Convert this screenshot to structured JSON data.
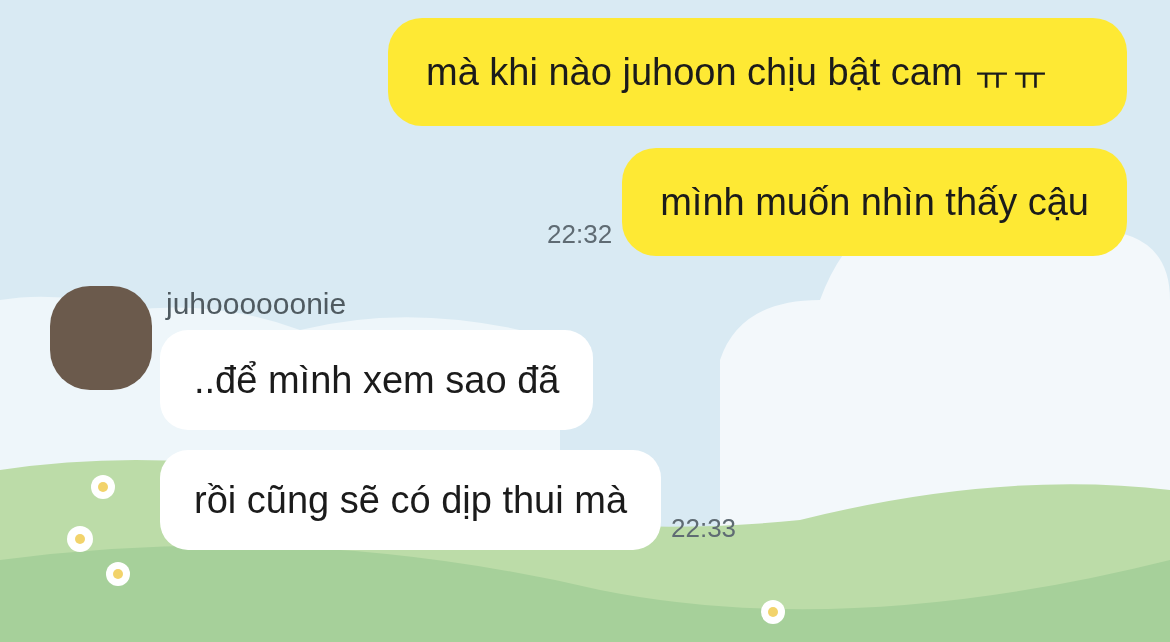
{
  "conversation": [
    {
      "kind": "outgoing",
      "bubbles": [
        {
          "text": "mà khi nào juhoon chịu bật cam ㅠㅠ"
        },
        {
          "text": "mình muốn nhìn thấy cậu",
          "time": "22:32"
        }
      ]
    },
    {
      "kind": "incoming",
      "sender": "juhoooooonie",
      "bubbles": [
        {
          "text": "..để mình xem sao đã"
        },
        {
          "text": "rồi cũng sẽ có dịp thui mà",
          "time": "22:33"
        }
      ]
    }
  ]
}
